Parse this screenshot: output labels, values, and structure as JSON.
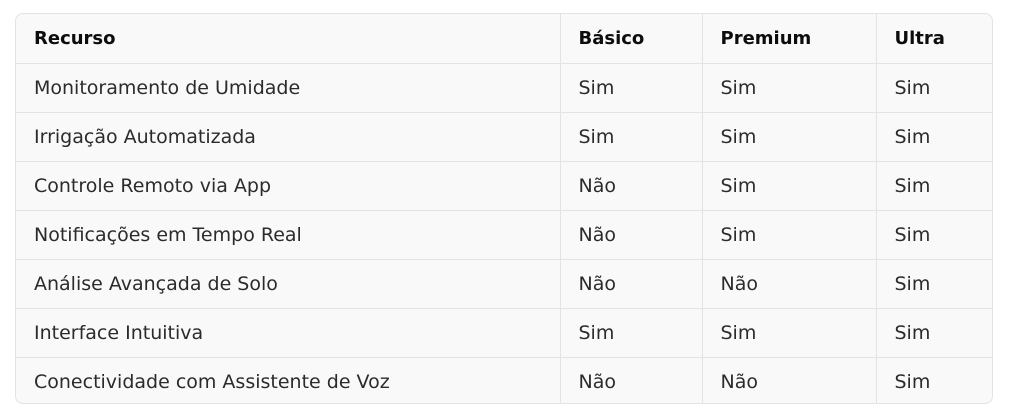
{
  "table": {
    "headers": [
      "Recurso",
      "Básico",
      "Premium",
      "Ultra"
    ],
    "rows": [
      [
        "Monitoramento de Umidade",
        "Sim",
        "Sim",
        "Sim"
      ],
      [
        "Irrigação Automatizada",
        "Sim",
        "Sim",
        "Sim"
      ],
      [
        "Controle Remoto via App",
        "Não",
        "Sim",
        "Sim"
      ],
      [
        "Notificações em Tempo Real",
        "Não",
        "Sim",
        "Sim"
      ],
      [
        "Análise Avançada de Solo",
        "Não",
        "Não",
        "Sim"
      ],
      [
        "Interface Intuitiva",
        "Sim",
        "Sim",
        "Sim"
      ],
      [
        "Conectividade com Assistente de Voz",
        "Não",
        "Não",
        "Sim"
      ]
    ]
  }
}
